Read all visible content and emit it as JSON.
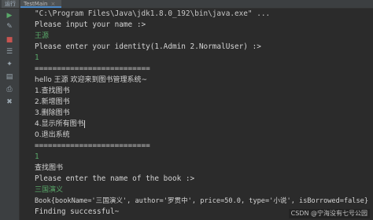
{
  "window": {
    "run_label": "运行",
    "tab_label": "TestMain",
    "tab_close": "×"
  },
  "gutter": {
    "icons": [
      "rerun-icon",
      "wrench-icon",
      "stop-icon",
      "scroll-icon",
      "pin-icon",
      "layout-icon",
      "print-icon",
      "trash-icon"
    ]
  },
  "console": {
    "lines": [
      {
        "text": "\"C:\\Program Files\\Java\\jdk1.8.0_192\\bin\\java.exe\" ...",
        "kind": "cmd"
      },
      {
        "text": "Please input your name :>",
        "kind": "out"
      },
      {
        "text": "王源",
        "kind": "user"
      },
      {
        "text": "Please enter your identity(1.Admin 2.NormalUser) :>",
        "kind": "out"
      },
      {
        "text": "1",
        "kind": "user"
      },
      {
        "text": "==========================",
        "kind": "out"
      },
      {
        "text": "hello 王源 欢迎来到图书管理系统~",
        "kind": "out"
      },
      {
        "text": "1.查找图书",
        "kind": "out"
      },
      {
        "text": "2.新增图书",
        "kind": "out"
      },
      {
        "text": "3.删除图书",
        "kind": "out"
      },
      {
        "text": "4.显示所有图书",
        "kind": "out"
      },
      {
        "text": "0.退出系统",
        "kind": "out"
      },
      {
        "text": "==========================",
        "kind": "out"
      },
      {
        "text": "1",
        "kind": "user"
      },
      {
        "text": "查找图书",
        "kind": "out"
      },
      {
        "text": "Please enter the name of the book :>",
        "kind": "out"
      },
      {
        "text": "三国演义",
        "kind": "user"
      },
      {
        "text": "Book{bookName='三国演义', author='罗贯中', price=50.0, type='小说', isBorrowed=false}",
        "kind": "out"
      },
      {
        "text": "Finding successful~",
        "kind": "out"
      },
      {
        "text": "==========================",
        "kind": "out"
      }
    ]
  },
  "watermark": {
    "text": "CSDN @宁海没有七号公园"
  },
  "colors": {
    "background": "#2b2b2b",
    "toolbar": "#3c3f41",
    "output_text": "#d4d4d4",
    "user_input": "#59a869",
    "tab_accent": "#4a88c7"
  }
}
